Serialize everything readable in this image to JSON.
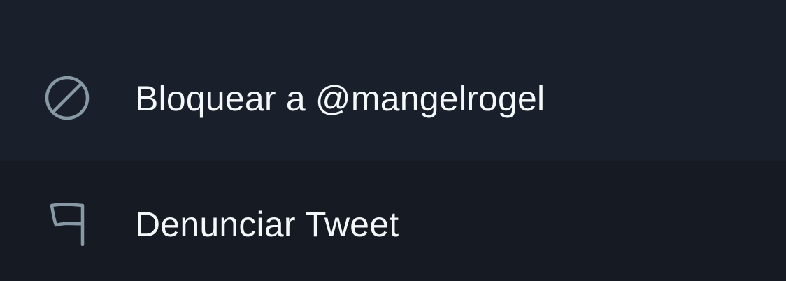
{
  "menu": {
    "items": [
      {
        "label": "Bloquear a @mangelrogel",
        "icon": "block-icon"
      },
      {
        "label": "Denunciar Tweet",
        "icon": "flag-icon"
      }
    ]
  },
  "colors": {
    "item_background": "#1a202b",
    "item_background_alt": "#151a23",
    "icon": "#8899a6",
    "text": "#f5f8fa"
  }
}
